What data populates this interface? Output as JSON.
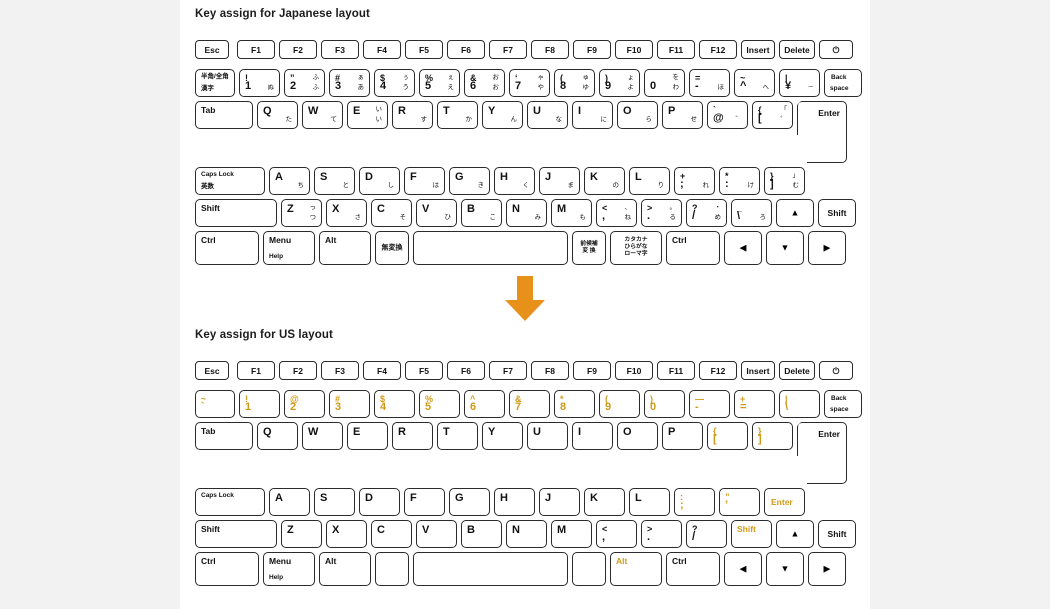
{
  "colors": {
    "accent_orange": "#e8911a",
    "label_orange": "#d19a16",
    "key_border": "#2b2b2b",
    "background": "#ffffff",
    "gutter": "#f2f2f2"
  },
  "sections": {
    "japanese": {
      "title": "Key assign for Japanese layout"
    },
    "us": {
      "title": "Key assign for US layout"
    }
  },
  "arrow": {
    "name": "down-arrow",
    "color": "#e8911a"
  },
  "function_row": {
    "esc": "Esc",
    "f1": "F1",
    "f2": "F2",
    "f3": "F3",
    "f4": "F4",
    "f5": "F5",
    "f6": "F6",
    "f7": "F7",
    "f8": "F8",
    "f9": "F9",
    "f10": "F10",
    "f11": "F11",
    "f12": "F12",
    "insert": "Insert",
    "delete": "Delete",
    "power": "⏻"
  },
  "jp": {
    "row_num": {
      "hankaku": {
        "top": "半角/全角",
        "bottom": "漢字"
      },
      "keys": [
        {
          "tl": "!",
          "bl": "1",
          "tr": "",
          "br": "ぬ"
        },
        {
          "tl": "”",
          "bl": "2",
          "tr": "ふ",
          "br": "ふ"
        },
        {
          "tl": "#",
          "bl": "3",
          "tr": "ぁ",
          "br": "あ"
        },
        {
          "tl": "$",
          "bl": "4",
          "tr": "ぅ",
          "br": "う"
        },
        {
          "tl": "%",
          "bl": "5",
          "tr": "ぇ",
          "br": "え"
        },
        {
          "tl": "&",
          "bl": "6",
          "tr": "お",
          "br": "お"
        },
        {
          "tl": "‘",
          "bl": "7",
          "tr": "ゃ",
          "br": "や"
        },
        {
          "tl": "(",
          "bl": "8",
          "tr": "ゅ",
          "br": "ゆ"
        },
        {
          "tl": ")",
          "bl": "9",
          "tr": "ょ",
          "br": "よ"
        },
        {
          "tl": "",
          "bl": "0",
          "tr": "を",
          "br": "わ"
        },
        {
          "tl": "=",
          "bl": "-",
          "tr": "",
          "br": "ほ"
        },
        {
          "tl": "~",
          "bl": "^",
          "tr": "",
          "br": "へ"
        },
        {
          "tl": "|",
          "bl": "¥",
          "tr": "",
          "br": "－"
        }
      ],
      "backspace": {
        "top": "Back",
        "bottom": "space"
      }
    },
    "row_q": {
      "tab": "Tab",
      "keys": [
        {
          "main": "Q",
          "kana": "た"
        },
        {
          "main": "W",
          "kana": "て"
        },
        {
          "main": "E",
          "kana": "い",
          "kana2": "い"
        },
        {
          "main": "R",
          "kana": "す"
        },
        {
          "main": "T",
          "kana": "か"
        },
        {
          "main": "Y",
          "kana": "ん"
        },
        {
          "main": "U",
          "kana": "な"
        },
        {
          "main": "I",
          "kana": "に"
        },
        {
          "main": "O",
          "kana": "ら"
        },
        {
          "main": "P",
          "kana": "せ"
        }
      ],
      "at": {
        "tl": "`",
        "bl": "@",
        "br": "゛"
      },
      "bracket": {
        "tl": "{",
        "bl": "[",
        "tr": "「",
        "br": "゜"
      },
      "enter": "Enter"
    },
    "row_a": {
      "capslock": {
        "top": "Caps Lock",
        "bottom": "英数"
      },
      "keys": [
        {
          "main": "A",
          "kana": "ち"
        },
        {
          "main": "S",
          "kana": "と"
        },
        {
          "main": "D",
          "kana": "し"
        },
        {
          "main": "F",
          "kana": "は"
        },
        {
          "main": "G",
          "kana": "き"
        },
        {
          "main": "H",
          "kana": "く"
        },
        {
          "main": "J",
          "kana": "ま"
        },
        {
          "main": "K",
          "kana": "の"
        },
        {
          "main": "L",
          "kana": "り"
        }
      ],
      "semicolon": {
        "tl": "+",
        "bl": ";",
        "br": "れ"
      },
      "colon": {
        "tl": "*",
        "bl": ":",
        "br": "け"
      },
      "brace": {
        "tl": "}",
        "bl": "]",
        "tr": "」",
        "br": "む"
      }
    },
    "row_z": {
      "shift": "Shift",
      "keys": [
        {
          "main": "Z",
          "kana": "っ",
          "kana2": "つ"
        },
        {
          "main": "X",
          "kana": "さ"
        },
        {
          "main": "C",
          "kana": "そ"
        },
        {
          "main": "V",
          "kana": "ひ"
        },
        {
          "main": "B",
          "kana": "こ"
        },
        {
          "main": "N",
          "kana": "み"
        },
        {
          "main": "M",
          "kana": "も"
        }
      ],
      "comma": {
        "tl": "<",
        "bl": ",",
        "tr": "、",
        "br": "ね"
      },
      "period": {
        "tl": ">",
        "bl": ".",
        "tr": "。",
        "br": "る"
      },
      "slash": {
        "tl": "?",
        "bl": "/",
        "tr": "・",
        "br": "め"
      },
      "underscore": {
        "tl": "_",
        "bl": "\\",
        "br": "ろ"
      },
      "up": "▲",
      "rshift": "Shift"
    },
    "row_ctrl": {
      "ctrl": "Ctrl",
      "menu": {
        "top": "Menu",
        "bottom": "Help"
      },
      "alt": "Alt",
      "muhenkan": "無変換",
      "space": "",
      "henkan": {
        "l1": "前候補",
        "l2": "変 換"
      },
      "kana": {
        "l1": "カタカナ",
        "l2": "ひらがな",
        "l3": "ローマ字"
      },
      "rctrl": "Ctrl",
      "left": "◀",
      "down": "▼",
      "right": "▶"
    }
  },
  "us": {
    "row_num": {
      "tilde": {
        "tl": "~",
        "bl": "`"
      },
      "keys": [
        {
          "tl": "!",
          "bl": "1"
        },
        {
          "tl": "@",
          "bl": "2"
        },
        {
          "tl": "#",
          "bl": "3"
        },
        {
          "tl": "$",
          "bl": "4"
        },
        {
          "tl": "%",
          "bl": "5"
        },
        {
          "tl": "^",
          "bl": "6"
        },
        {
          "tl": "&",
          "bl": "7"
        },
        {
          "tl": "*",
          "bl": "8"
        },
        {
          "tl": "(",
          "bl": "9"
        },
        {
          "tl": ")",
          "bl": "0"
        },
        {
          "tl": "—",
          "bl": "-"
        },
        {
          "tl": "+",
          "bl": "="
        },
        {
          "tl": "|",
          "bl": "\\"
        }
      ],
      "backspace": {
        "top": "Back",
        "bottom": "space"
      }
    },
    "row_q": {
      "tab": "Tab",
      "keys": [
        {
          "main": "Q"
        },
        {
          "main": "W"
        },
        {
          "main": "E"
        },
        {
          "main": "R"
        },
        {
          "main": "T"
        },
        {
          "main": "Y"
        },
        {
          "main": "U"
        },
        {
          "main": "I"
        },
        {
          "main": "O"
        },
        {
          "main": "P"
        }
      ],
      "lbracket": {
        "tl": "{",
        "bl": "["
      },
      "rbracket": {
        "tl": "}",
        "bl": "]"
      },
      "enter": "Enter"
    },
    "row_a": {
      "capslock": {
        "top": "Caps Lock"
      },
      "keys": [
        {
          "main": "A"
        },
        {
          "main": "S"
        },
        {
          "main": "D"
        },
        {
          "main": "F"
        },
        {
          "main": "G"
        },
        {
          "main": "H"
        },
        {
          "main": "J"
        },
        {
          "main": "K"
        },
        {
          "main": "L"
        }
      ],
      "semicolon": {
        "tl": ":",
        "bl": ";"
      },
      "quote": {
        "tl": "”",
        "bl": "’"
      },
      "enter_remap": "Enter"
    },
    "row_z": {
      "shift": "Shift",
      "keys": [
        {
          "main": "Z"
        },
        {
          "main": "X"
        },
        {
          "main": "C"
        },
        {
          "main": "V"
        },
        {
          "main": "B"
        },
        {
          "main": "N"
        },
        {
          "main": "M"
        }
      ],
      "comma": {
        "tl": "<",
        "bl": ","
      },
      "period": {
        "tl": ">",
        "bl": "."
      },
      "slash": {
        "tl": "?",
        "bl": "/"
      },
      "shift_remap": "Shift",
      "up": "▲",
      "rshift": "Shift"
    },
    "row_ctrl": {
      "ctrl": "Ctrl",
      "menu": {
        "top": "Menu",
        "bottom": "Help"
      },
      "alt": "Alt",
      "blank1": "",
      "space": "",
      "blank2": "",
      "alt_remap": "Alt",
      "rctrl": "Ctrl",
      "left": "◀",
      "down": "▼",
      "right": "▶"
    }
  }
}
